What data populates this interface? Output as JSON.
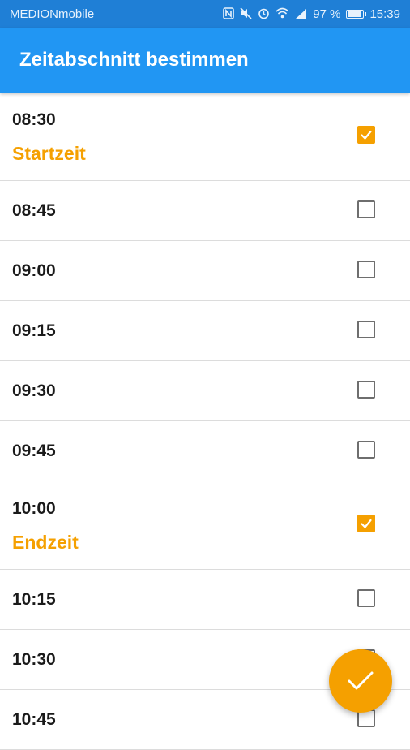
{
  "status_bar": {
    "carrier": "MEDIONmobile",
    "battery": "97 %",
    "time": "15:39",
    "icons": [
      "nfc-icon",
      "mute-icon",
      "alarm-icon",
      "wifi-icon",
      "signal-icon",
      "battery-icon"
    ]
  },
  "app_bar": {
    "title": "Zeitabschnitt bestimmen"
  },
  "colors": {
    "primary": "#2196f3",
    "status_bar": "#1f7fd6",
    "accent": "#f5a000"
  },
  "slots": [
    {
      "time": "08:30",
      "label": "Startzeit",
      "checked": true
    },
    {
      "time": "08:45",
      "label": "",
      "checked": false
    },
    {
      "time": "09:00",
      "label": "",
      "checked": false
    },
    {
      "time": "09:15",
      "label": "",
      "checked": false
    },
    {
      "time": "09:30",
      "label": "",
      "checked": false
    },
    {
      "time": "09:45",
      "label": "",
      "checked": false
    },
    {
      "time": "10:00",
      "label": "Endzeit",
      "checked": true
    },
    {
      "time": "10:15",
      "label": "",
      "checked": false
    },
    {
      "time": "10:30",
      "label": "",
      "checked": false
    },
    {
      "time": "10:45",
      "label": "",
      "checked": false
    }
  ],
  "fab": {
    "icon": "check-icon"
  }
}
